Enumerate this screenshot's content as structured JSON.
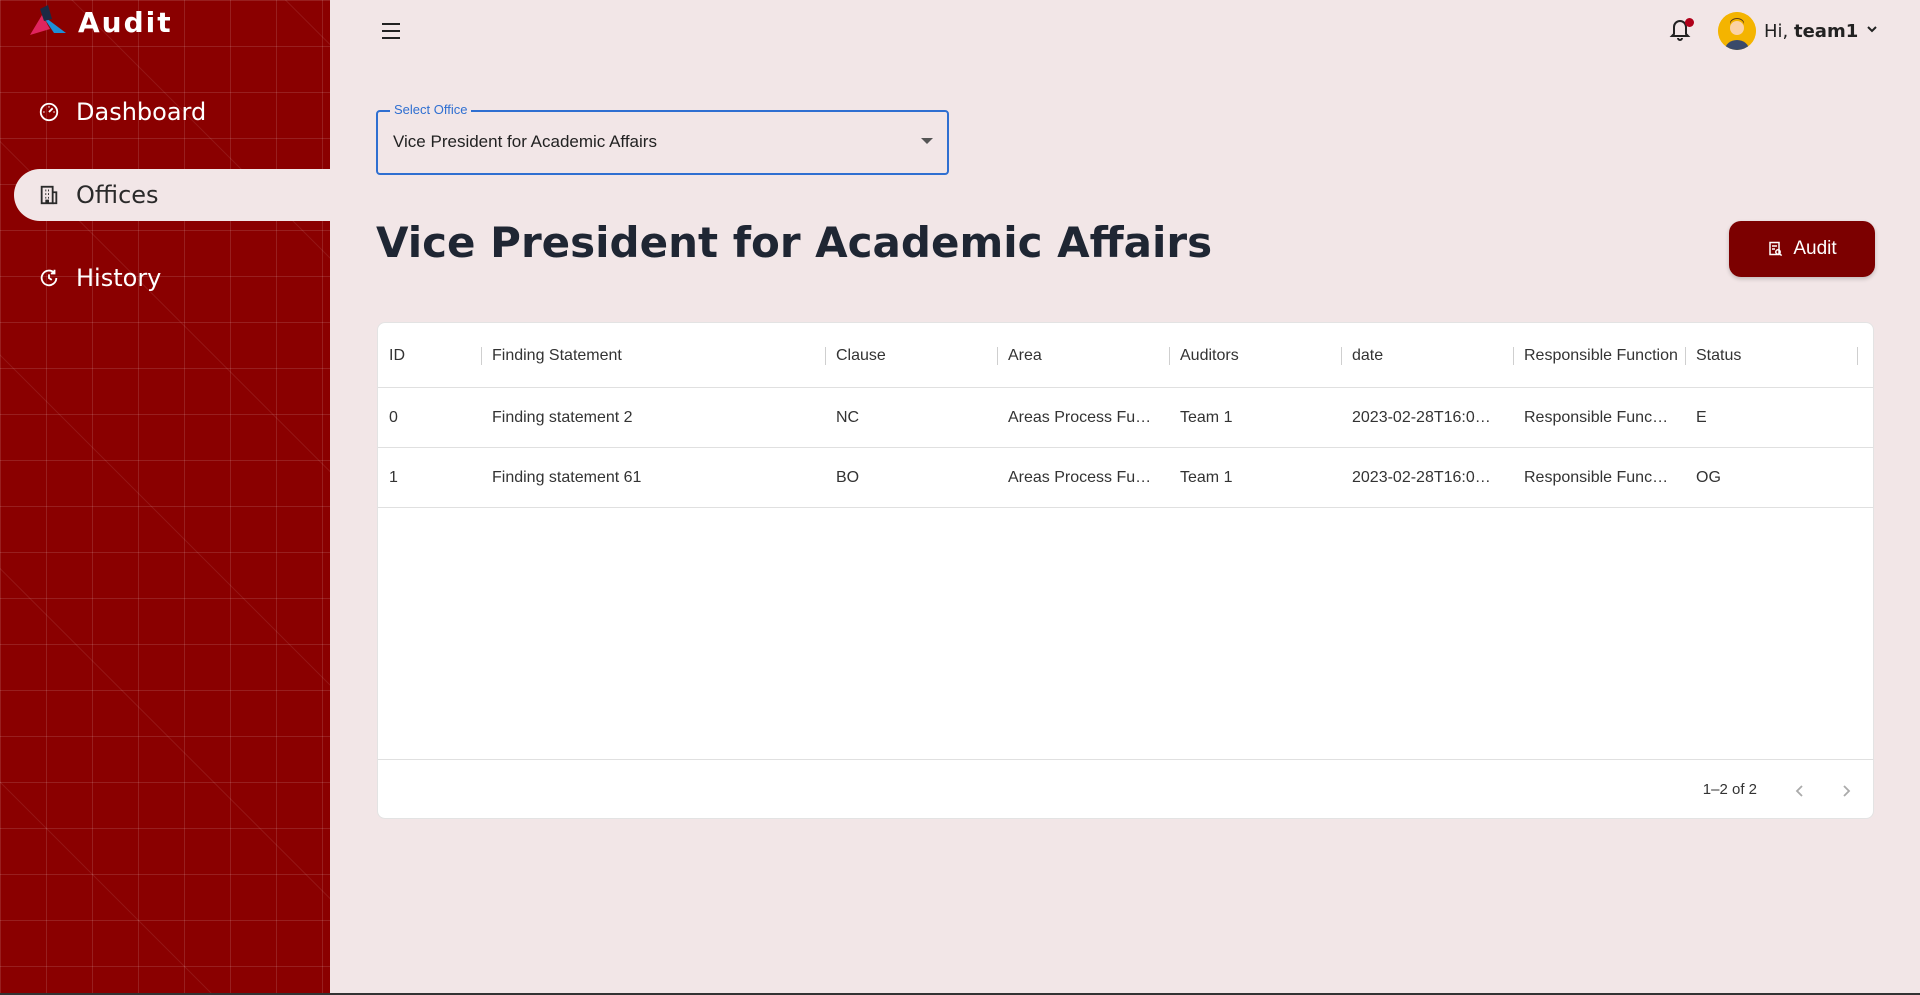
{
  "brand": {
    "name": "Audit"
  },
  "sidebar": {
    "items": [
      {
        "label": "Dashboard",
        "icon": "speedometer-icon",
        "active": false
      },
      {
        "label": "Offices",
        "icon": "building-icon",
        "active": true
      },
      {
        "label": "History",
        "icon": "history-icon",
        "active": false
      }
    ]
  },
  "topbar": {
    "greeting_prefix": "Hi, ",
    "username": "team1",
    "has_notification": true
  },
  "office_select": {
    "label": "Select Office",
    "value": "Vice President for Academic Affairs"
  },
  "page": {
    "title": "Vice President for Academic Affairs",
    "audit_button": "Audit"
  },
  "table": {
    "columns": [
      "ID",
      "Finding Statement",
      "Clause",
      "Area",
      "Auditors",
      "date",
      "Responsible Function",
      "Status"
    ],
    "rows": [
      [
        "0",
        "Finding statement 2",
        "NC",
        "Areas Process Fu…",
        "Team 1",
        "2023-02-28T16:0…",
        "Responsible Func…",
        "E"
      ],
      [
        "1",
        "Finding statement 61",
        "BO",
        "Areas Process Fu…",
        "Team 1",
        "2023-02-28T16:0…",
        "Responsible Func…",
        "OG"
      ]
    ],
    "pagination": "1–2 of 2"
  },
  "colors": {
    "sidebar": "#8a0000",
    "accent": "#7c0000",
    "background": "#f2e6e7",
    "focus": "#2f6fd1"
  }
}
